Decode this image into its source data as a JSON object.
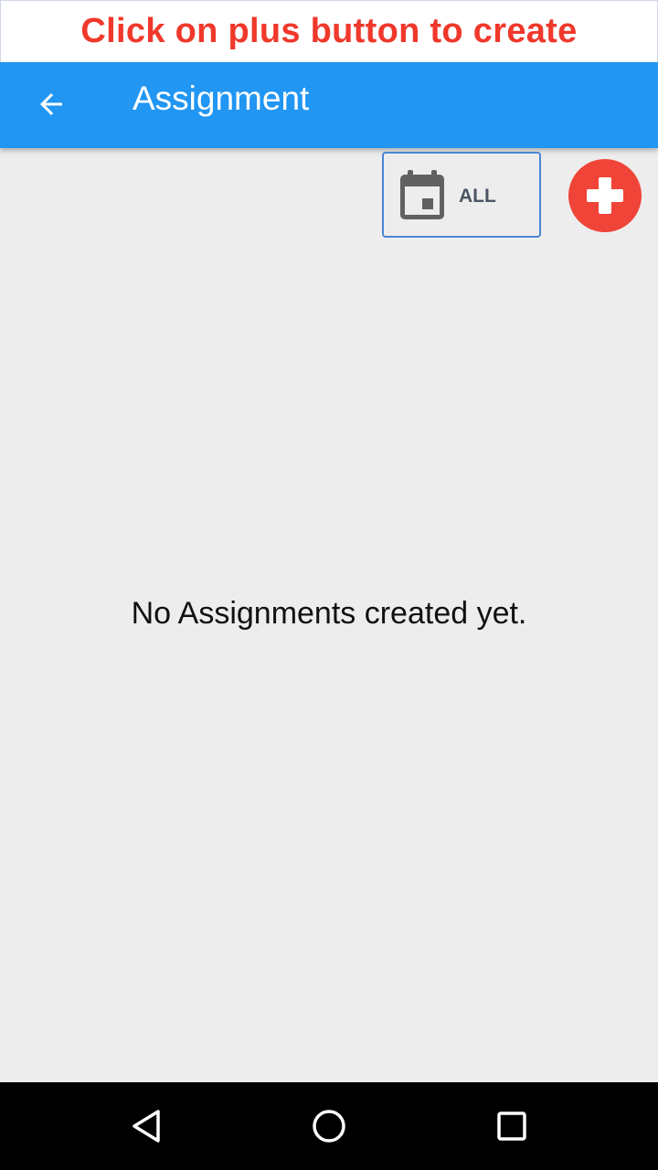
{
  "banner": {
    "text": "Click on plus button to create"
  },
  "appbar": {
    "title": "Assignment",
    "back_icon": "arrow-left-icon",
    "color": "#2196f3"
  },
  "filter": {
    "label": "ALL",
    "icon": "calendar-icon"
  },
  "add_button": {
    "icon": "plus-icon",
    "color": "#f04438"
  },
  "empty_state": {
    "message": "No Assignments created yet."
  },
  "navbar": {
    "back_icon": "triangle-back-icon",
    "home_icon": "circle-home-icon",
    "recents_icon": "square-recents-icon"
  }
}
